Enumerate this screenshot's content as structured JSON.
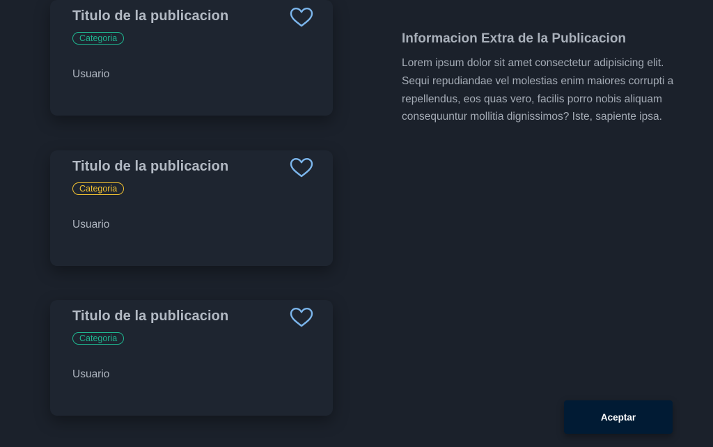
{
  "cards": [
    {
      "title": "Titulo de la publicacion",
      "category": "Categoria",
      "category_color": "#1fb58f",
      "user": "Usuario",
      "icon": "heart-outline-icon"
    },
    {
      "title": "Titulo de la publicacion",
      "category": "Categoria",
      "category_color": "#f1c232",
      "user": "Usuario",
      "icon": "heart-outline-icon"
    },
    {
      "title": "Titulo de la publicacion",
      "category": "Categoria",
      "category_color": "#1fb58f",
      "user": "Usuario",
      "icon": "heart-outline-icon"
    }
  ],
  "info": {
    "title": "Informacion Extra de la Publicacion",
    "body": "Lorem ipsum dolor sit amet consectetur adipisicing elit. Sequi repudiandae vel molestias enim maiores corrupti a repellendus, eos quas vero, facilis porro nobis aliquam consequuntur mollitia dignissimos? Iste, sapiente ipsa."
  },
  "actions": {
    "accept_label": "Aceptar"
  },
  "colors": {
    "background": "#1b212b",
    "card": "#1e2530",
    "heart": "#7cb6ec",
    "button": "#011b34"
  }
}
